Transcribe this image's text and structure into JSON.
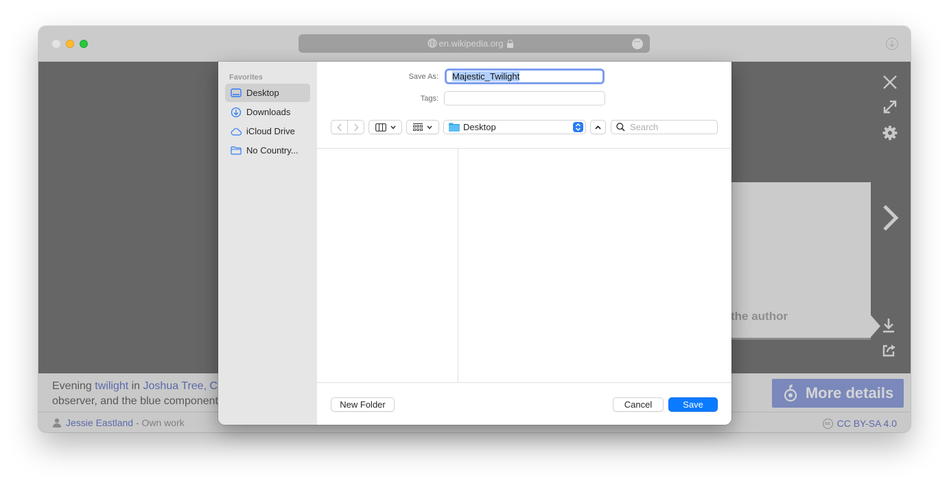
{
  "browser": {
    "url": "en.wikipedia.org",
    "icons": {
      "globe": "globe-icon",
      "lock": "lock-icon",
      "more": "ellipsis-icon",
      "downloads": "download-circle-icon"
    }
  },
  "media_viewer": {
    "tools": [
      "close-icon",
      "fullscreen-icon",
      "settings-gear-icon",
      "next-chevron-icon",
      "download-icon",
      "share-icon"
    ],
    "card_partial_text": "the author",
    "caption": {
      "line1_prefix": "Evening ",
      "line1_link1": "twilight",
      "line1_mid": " in ",
      "line1_link2": "Joshua Tree, C",
      "line2": "observer, and the blue component"
    },
    "more_details_label": "More details",
    "credit": {
      "author": "Jessie Eastland",
      "suffix": " - Own work"
    },
    "license": "CC BY-SA 4.0",
    "license_icon_text": "cc"
  },
  "save_dialog": {
    "sidebar": {
      "section": "Favorites",
      "items": [
        {
          "label": "Desktop",
          "icon": "desktop-icon",
          "selected": true
        },
        {
          "label": "Downloads",
          "icon": "downloads-icon",
          "selected": false
        },
        {
          "label": "iCloud Drive",
          "icon": "icloud-icon",
          "selected": false
        },
        {
          "label": "No Country...",
          "icon": "folder-icon",
          "selected": false
        }
      ]
    },
    "save_as_label": "Save As:",
    "save_as_value": "Majestic_Twilight",
    "tags_label": "Tags:",
    "tags_value": "",
    "location": "Desktop",
    "search_placeholder": "Search",
    "buttons": {
      "new_folder": "New Folder",
      "cancel": "Cancel",
      "save": "Save"
    },
    "accent_color": "#0a7aff"
  }
}
